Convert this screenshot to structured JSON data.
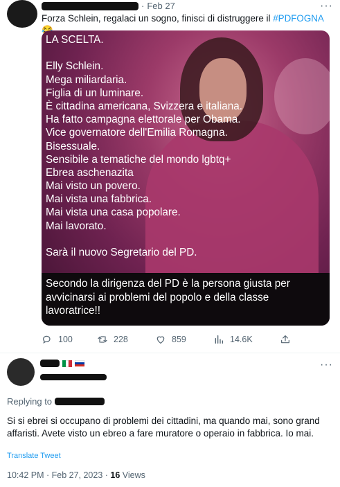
{
  "tweet": {
    "date": "Feb 27",
    "text": "Forza Schlein, regalaci un sogno, finisci di distruggere il ",
    "hashtag": "#PDFOGNA",
    "emoji": "😂",
    "more": "···",
    "image_lines": [
      "LA SCELTA.",
      "",
      "Elly Schlein.",
      "Mega miliardaria.",
      "Figlia di un luminare.",
      "È cittadina americana, Svizzera e italiana.",
      "Ha fatto campagna elettorale per Obama.",
      "Vice governatore dell'Emilia Romagna.",
      "Bisessuale.",
      "Sensibile a tematiche del mondo lgbtq+",
      "Ebrea aschenazita",
      "Mai visto un povero.",
      "Mai vista una fabbrica.",
      "Mai vista una casa popolare.",
      "Mai lavorato.",
      "",
      "Sarà il nuovo Segretario del PD."
    ],
    "image_band_text": "Secondo la dirigenza del PD è la persona giusta per avvicinarsi ai problemi del popolo e della classe lavoratrice!!",
    "actions": {
      "replies": "100",
      "retweets": "228",
      "likes": "859",
      "views": "14.6K"
    }
  },
  "reply": {
    "more": "···",
    "replying_to": "Replying to",
    "text": "Si si ebrei si occupano di problemi dei cittadini, ma quando mai, sono grand affaristi. Avete visto un ebreo a fare muratore o operaio in fabbrica. Io mai.",
    "translate": "Translate Tweet",
    "timestamp": "10:42 PM · Feb 27, 2023 · ",
    "views_count": "16",
    "views_label": " Views"
  },
  "colors": {
    "accent": "#1d9bf0",
    "secondary_text": "#536471",
    "primary_text": "#0f1419"
  },
  "icons": [
    "reply-icon",
    "retweet-icon",
    "like-icon",
    "views-icon",
    "share-icon",
    "more-icon"
  ]
}
